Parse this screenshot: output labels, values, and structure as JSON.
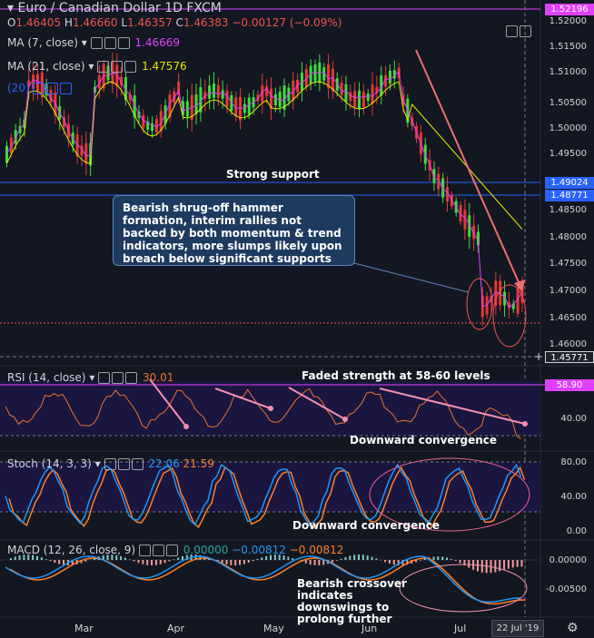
{
  "header": {
    "title": "Euro / Canadian Dollar  1D  FXCM",
    "ohlc": {
      "o_label": "O",
      "o": "1.46405",
      "h_label": "H",
      "h": "1.46660",
      "l_label": "L",
      "l": "1.46357",
      "c_label": "C",
      "c": "1.46383",
      "change": "−0.00127 (−0.09%)"
    }
  },
  "indicators": {
    "ma7": {
      "label": "MA (7, close)",
      "value": "1.46669"
    },
    "ma21": {
      "label": "MA (21, close)",
      "value": "1.47576"
    },
    "ma20": {
      "label": "(20)"
    },
    "rsi": {
      "label": "RSI (14, close)",
      "value": "30.01"
    },
    "stoch": {
      "label": "Stoch (14, 3, 3)",
      "k": "22.06",
      "d": "21.59"
    },
    "macd": {
      "label": "MACD (12, 26, close, 9)",
      "hist": "0.00000",
      "macd": "−0.00812",
      "signal": "−0.00812"
    }
  },
  "price_axis": {
    "ticks": [
      "1.52000",
      "1.51500",
      "1.51000",
      "1.50500",
      "1.50000",
      "1.49500",
      "1.48500",
      "1.48000",
      "1.47500",
      "1.47000",
      "1.46500",
      "1.46000"
    ],
    "tags": {
      "top": "1.52196",
      "support1": "1.49024",
      "support2": "1.48771",
      "bottom": "1.45771"
    }
  },
  "rsi_axis": {
    "tag": "58.90",
    "tick": "40.00"
  },
  "stoch_axis": {
    "ticks": [
      "80.00",
      "40.00",
      "0.00"
    ]
  },
  "macd_axis": {
    "ticks": [
      "0.00000",
      "-0.00500"
    ]
  },
  "time_axis": {
    "months": [
      "Mar",
      "Apr",
      "May",
      "Jun",
      "Jul"
    ],
    "current_date": "22 Jul '19"
  },
  "annotations": {
    "strong_support": "Strong support",
    "callout": "Bearish shrug-off hammer formation, interim rallies not backed by both momentum & trend indicators, more slumps likely upon breach below significant supports",
    "rsi_note": "Faded strength at 58-60 levels",
    "rsi_conv": "Downward convergence",
    "stoch_conv": "Downward convergence",
    "macd_note": "Bearish crossover indicates downswings to prolong further"
  },
  "colors": {
    "bull": "#26a69a",
    "bull_candle": "#3ddc3d",
    "bear": "#e53935",
    "ma7": "#e040fb",
    "ma21": "#e6e600",
    "rsi": "#e8722e",
    "stoch_k": "#2196f3",
    "stoch_d": "#ff7f27",
    "trendline": "#f06e6e"
  }
}
